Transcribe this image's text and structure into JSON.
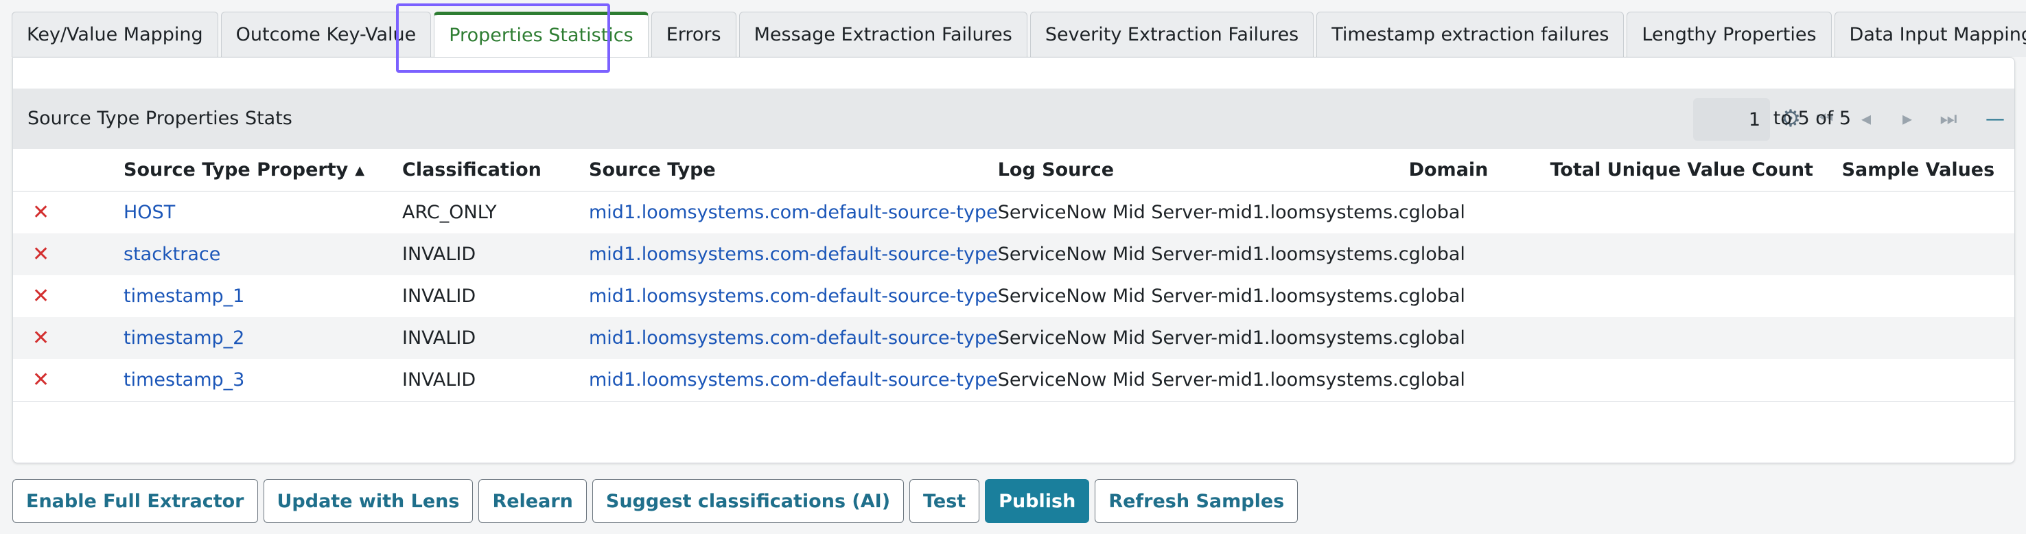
{
  "tabs": [
    {
      "label": "Key/Value Mapping",
      "active": false
    },
    {
      "label": "Outcome Key-Value",
      "active": false
    },
    {
      "label": "Properties Statistics",
      "active": true
    },
    {
      "label": "Errors",
      "active": false
    },
    {
      "label": "Message Extraction Failures",
      "active": false
    },
    {
      "label": "Severity Extraction Failures",
      "active": false
    },
    {
      "label": "Timestamp extraction failures",
      "active": false
    },
    {
      "label": "Lengthy Properties",
      "active": false
    },
    {
      "label": "Data Input Mappings",
      "active": false
    }
  ],
  "panel": {
    "title": "Source Type Properties Stats",
    "pager": {
      "current_page": "1",
      "range_text": "to 5 of 5"
    }
  },
  "table": {
    "columns": [
      "Source Type Property",
      "Classification",
      "Source Type",
      "Log Source",
      "Domain",
      "Total Unique Value Count",
      "Sample Values"
    ],
    "rows": [
      {
        "property": "HOST",
        "classification": "ARC_ONLY",
        "source_type": "mid1.loomsystems.com-default-source-type",
        "log_source": "ServiceNow Mid Server-mid1.loomsystems.c",
        "domain": "global",
        "total_unique": "",
        "samples": ""
      },
      {
        "property": "stacktrace",
        "classification": "INVALID",
        "source_type": "mid1.loomsystems.com-default-source-type",
        "log_source": "ServiceNow Mid Server-mid1.loomsystems.c",
        "domain": "global",
        "total_unique": "",
        "samples": ""
      },
      {
        "property": "timestamp_1",
        "classification": "INVALID",
        "source_type": "mid1.loomsystems.com-default-source-type",
        "log_source": "ServiceNow Mid Server-mid1.loomsystems.c",
        "domain": "global",
        "total_unique": "",
        "samples": ""
      },
      {
        "property": "timestamp_2",
        "classification": "INVALID",
        "source_type": "mid1.loomsystems.com-default-source-type",
        "log_source": "ServiceNow Mid Server-mid1.loomsystems.c",
        "domain": "global",
        "total_unique": "",
        "samples": ""
      },
      {
        "property": "timestamp_3",
        "classification": "INVALID",
        "source_type": "mid1.loomsystems.com-default-source-type",
        "log_source": "ServiceNow Mid Server-mid1.loomsystems.c",
        "domain": "global",
        "total_unique": "",
        "samples": ""
      }
    ]
  },
  "actions": [
    {
      "label": "Enable Full Extractor",
      "primary": false
    },
    {
      "label": "Update with Lens",
      "primary": false
    },
    {
      "label": "Relearn",
      "primary": false
    },
    {
      "label": "Suggest classifications (AI)",
      "primary": false
    },
    {
      "label": "Test",
      "primary": false
    },
    {
      "label": "Publish",
      "primary": true
    },
    {
      "label": "Refresh Samples",
      "primary": false
    }
  ],
  "icons": {
    "delete": "x-icon",
    "settings": "gear-icon",
    "first_page": "first-page-icon",
    "prev_page": "prev-page-icon",
    "next_page": "next-page-icon",
    "last_page": "last-page-icon",
    "collapse": "minus-icon",
    "sort": "sort-ascending-icon"
  },
  "colors": {
    "active_tab": "#2e7d32",
    "link": "#1b56b8",
    "delete_icon": "#d32f2f",
    "primary_button": "#1a7f9c",
    "focus_ring": "#7b61ff"
  }
}
